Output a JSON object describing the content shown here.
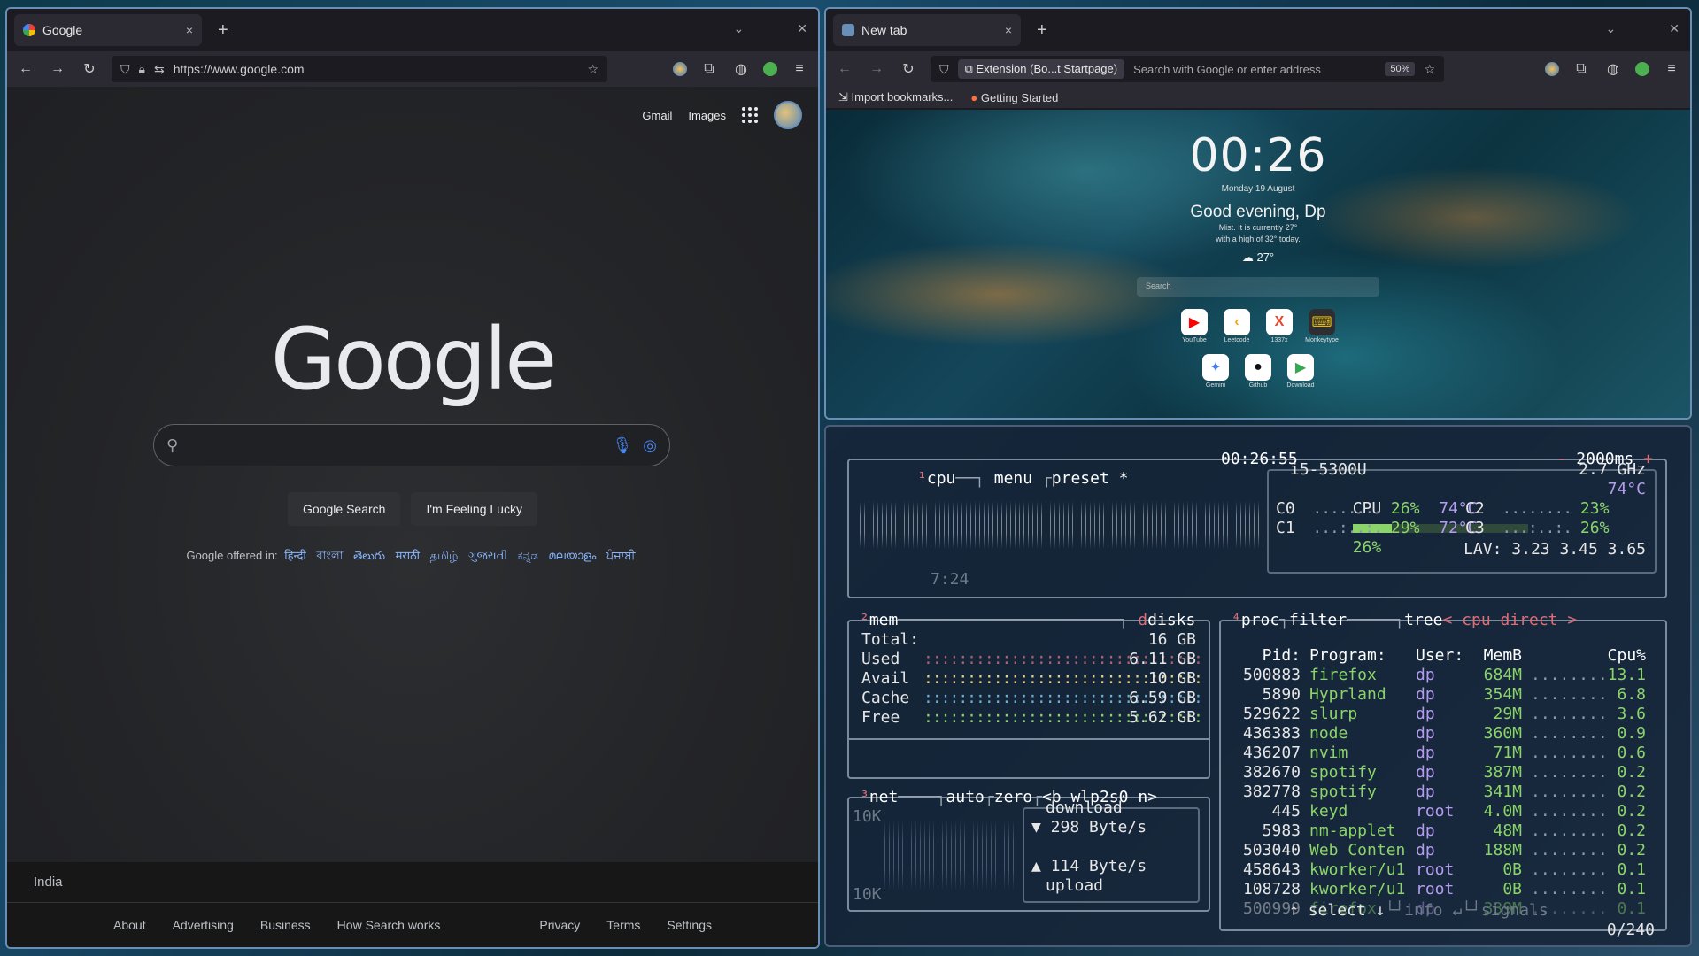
{
  "left_browser": {
    "tab": {
      "title": "Google",
      "close": "×"
    },
    "new_tab": "+",
    "url": "https://www.google.com",
    "page": {
      "top_links": {
        "gmail": "Gmail",
        "images": "Images"
      },
      "logo": "Google",
      "search_placeholder": "",
      "buttons": {
        "search": "Google Search",
        "lucky": "I'm Feeling Lucky"
      },
      "offered_in_label": "Google offered in:",
      "languages": [
        "हिन्दी",
        "বাংলা",
        "తెలుగు",
        "मराठी",
        "தமிழ்",
        "ગુજરાતી",
        "ಕನ್ನಡ",
        "മലയാളം",
        "ਪੰਜਾਬੀ"
      ],
      "footer": {
        "country": "India",
        "left_links": [
          "About",
          "Advertising",
          "Business",
          "How Search works"
        ],
        "right_links": [
          "Privacy",
          "Terms",
          "Settings"
        ]
      }
    }
  },
  "right_browser": {
    "tab": {
      "title": "New tab",
      "close": "×"
    },
    "new_tab": "+",
    "identity": "Extension (Bo...t Startpage)",
    "url_placeholder": "Search with Google or enter address",
    "zoom": "50%",
    "bookmarks": {
      "import": "Import bookmarks...",
      "getting_started": "Getting Started"
    },
    "startpage": {
      "clock": "00:26",
      "date": "Monday 19 August",
      "greeting": "Good evening, Dp",
      "weather_line1": "Mist. It is currently 27°",
      "weather_line2": "with a high of 32° today.",
      "temp": "27°",
      "search_placeholder": "Search",
      "links": [
        {
          "label": "YouTube",
          "glyph": "▶",
          "bg": "#ffffff",
          "fg": "#ff0000"
        },
        {
          "label": "Leetcode",
          "glyph": "‹",
          "bg": "#ffffff",
          "fg": "#f89f1b"
        },
        {
          "label": "1337x",
          "glyph": "X",
          "bg": "#ffffff",
          "fg": "#e8452c"
        },
        {
          "label": "Monkeytype",
          "glyph": "⌨",
          "bg": "#2c2e31",
          "fg": "#e2b714"
        },
        {
          "label": "Gemini",
          "glyph": "✦",
          "bg": "#ffffff",
          "fg": "#4a7ee8"
        },
        {
          "label": "Github",
          "glyph": "●",
          "bg": "#ffffff",
          "fg": "#111111"
        },
        {
          "label": "Download",
          "glyph": "▶",
          "bg": "#ffffff",
          "fg": "#34a853"
        }
      ]
    }
  },
  "btop": {
    "cpu_box": {
      "title_cpu": "cpu",
      "title_menu": "menu",
      "title_preset": "preset *",
      "time": "00:26:55",
      "interval": "2000ms",
      "model": "i5-5300U",
      "freq": "2.7 GHz",
      "uptime": "7:24",
      "cpu_label": "CPU",
      "cpu_pct": "26%",
      "cpu_temp": "74°C",
      "c0_label": "C0",
      "c0_pct": "26%",
      "c0_temp": "74°C",
      "c1_label": "C1",
      "c1_pct": "29%",
      "c1_temp": "72°C",
      "c2_label": "C2",
      "c2_pct": "23%",
      "c3_label": "C3",
      "c3_pct": "26%",
      "lav": "LAV: 3.23 3.45 3.65"
    },
    "mem_box": {
      "title_mem": "mem",
      "title_disks": "disks",
      "rows": [
        {
          "label": "Total:",
          "value": "16 GB"
        },
        {
          "label": "Used",
          "value": "6.11 GB"
        },
        {
          "label": "Avail",
          "value": "10 GB"
        },
        {
          "label": "Cache",
          "value": "6.59 GB"
        },
        {
          "label": "Free",
          "value": "5.62 GB"
        }
      ]
    },
    "net_box": {
      "title_net": "net",
      "title_auto": "auto",
      "title_zero": "zero",
      "title_iface": "<b wlp2s0 n>",
      "scale_top": "10K",
      "scale_bottom": "10K",
      "download_label": "download",
      "download_rate": "▼ 298 Byte/s",
      "upload_rate": "▲ 114 Byte/s",
      "upload_label": "upload"
    },
    "proc_box": {
      "title_proc": "proc",
      "title_filter": "filter",
      "title_tree": "tree",
      "title_sort": "< cpu direct >",
      "headers": {
        "pid": "Pid:",
        "program": "Program:",
        "user": "User:",
        "mem": "MemB",
        "cpu": "Cpu%"
      },
      "rows": [
        {
          "pid": "500883",
          "program": "firefox",
          "user": "dp",
          "mem": "684M",
          "cpu": "13.1"
        },
        {
          "pid": "5890",
          "program": "Hyprland",
          "user": "dp",
          "mem": "354M",
          "cpu": "6.8"
        },
        {
          "pid": "529622",
          "program": "slurp",
          "user": "dp",
          "mem": "29M",
          "cpu": "3.6"
        },
        {
          "pid": "436383",
          "program": "node",
          "user": "dp",
          "mem": "360M",
          "cpu": "0.9"
        },
        {
          "pid": "436207",
          "program": "nvim",
          "user": "dp",
          "mem": "71M",
          "cpu": "0.6"
        },
        {
          "pid": "382670",
          "program": "spotify",
          "user": "dp",
          "mem": "387M",
          "cpu": "0.2"
        },
        {
          "pid": "382778",
          "program": "spotify",
          "user": "dp",
          "mem": "341M",
          "cpu": "0.2"
        },
        {
          "pid": "445",
          "program": "keyd",
          "user": "root",
          "mem": "4.0M",
          "cpu": "0.2"
        },
        {
          "pid": "5983",
          "program": "nm-applet",
          "user": "dp",
          "mem": "48M",
          "cpu": "0.2"
        },
        {
          "pid": "503040",
          "program": "Web Conten",
          "user": "dp",
          "mem": "188M",
          "cpu": "0.2"
        },
        {
          "pid": "458643",
          "program": "kworker/u1",
          "user": "root",
          "mem": "0B",
          "cpu": "0.1"
        },
        {
          "pid": "108728",
          "program": "kworker/u1",
          "user": "root",
          "mem": "0B",
          "cpu": "0.1"
        },
        {
          "pid": "500999",
          "program": "firefox",
          "user": "dp",
          "mem": "339M",
          "cpu": "0.1"
        }
      ],
      "footer_select": "select",
      "footer_info": "info",
      "footer_signals": "signals",
      "footer_count": "0/240"
    }
  }
}
